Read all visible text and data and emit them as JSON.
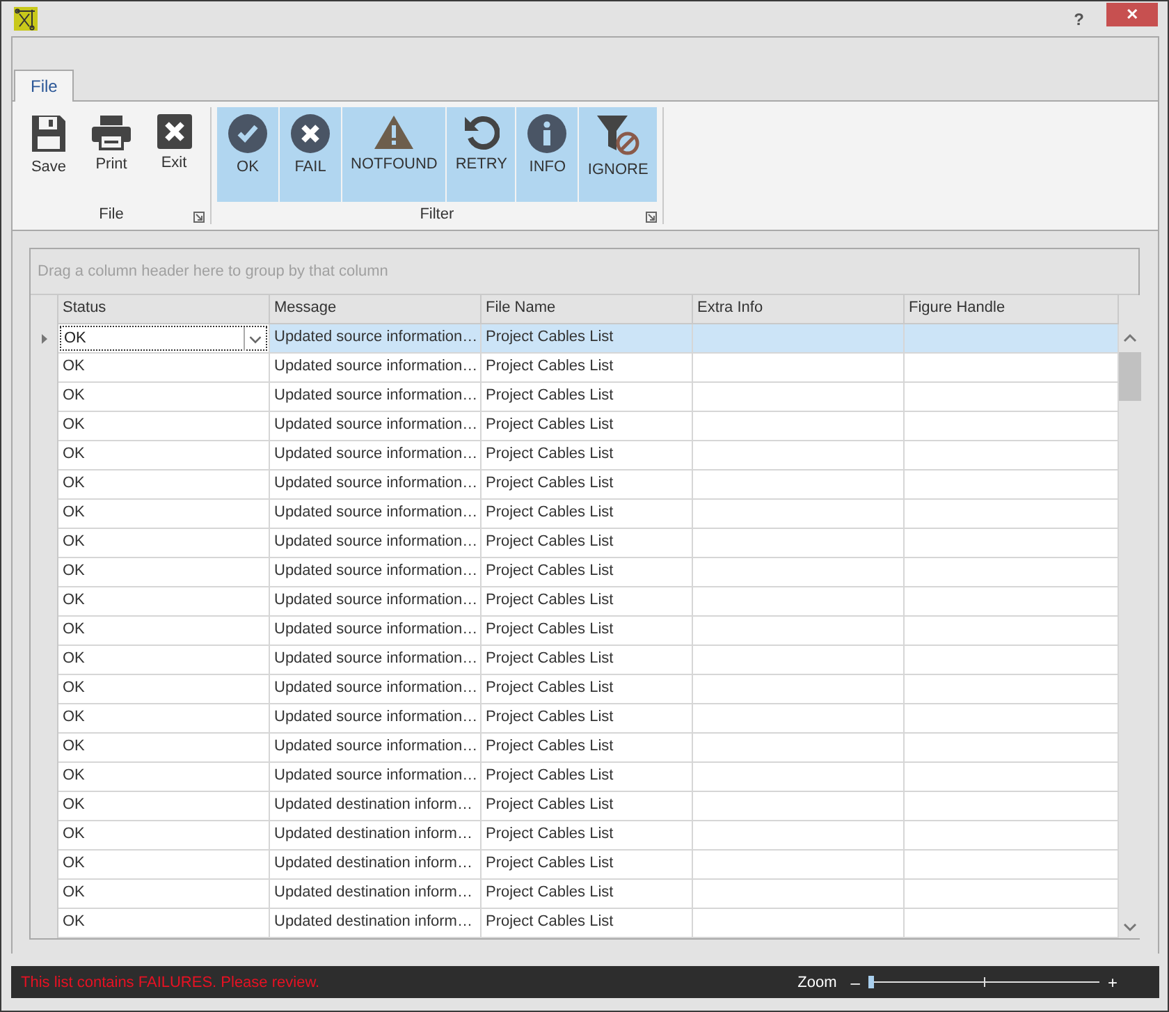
{
  "window": {
    "help": "?",
    "close": "✕"
  },
  "ribbon": {
    "tabs": [
      {
        "label": "File",
        "selected": true
      }
    ],
    "groups": [
      {
        "label": "File",
        "buttons": [
          {
            "label": "Save",
            "kind": "save",
            "selected": false
          },
          {
            "label": "Print",
            "kind": "print",
            "selected": false
          },
          {
            "label": "Exit",
            "kind": "exit",
            "selected": false
          }
        ]
      },
      {
        "label": "Filter",
        "buttons": [
          {
            "label": "OK",
            "kind": "ok",
            "selected": true
          },
          {
            "label": "FAIL",
            "kind": "fail",
            "selected": true
          },
          {
            "label": "NOTFOUND",
            "kind": "notfound",
            "selected": true
          },
          {
            "label": "RETRY",
            "kind": "retry",
            "selected": true
          },
          {
            "label": "INFO",
            "kind": "info",
            "selected": true
          },
          {
            "label": "IGNORE",
            "kind": "ignore",
            "selected": true
          }
        ]
      }
    ]
  },
  "grid": {
    "group_panel": "Drag a column header here to group by that column",
    "columns": [
      "Status",
      "Message",
      "File Name",
      "Extra Info",
      "Figure Handle"
    ],
    "rows": [
      {
        "status": "OK",
        "message": "Updated source information…",
        "file_name": "Project Cables List",
        "selected": true
      },
      {
        "status": "OK",
        "message": "Updated source information…",
        "file_name": "Project Cables List",
        "selected": false
      },
      {
        "status": "OK",
        "message": "Updated source information…",
        "file_name": "Project Cables List",
        "selected": false
      },
      {
        "status": "OK",
        "message": "Updated source information…",
        "file_name": "Project Cables List",
        "selected": false
      },
      {
        "status": "OK",
        "message": "Updated source information…",
        "file_name": "Project Cables List",
        "selected": false
      },
      {
        "status": "OK",
        "message": "Updated source information…",
        "file_name": "Project Cables List",
        "selected": false
      },
      {
        "status": "OK",
        "message": "Updated source information…",
        "file_name": "Project Cables List",
        "selected": false
      },
      {
        "status": "OK",
        "message": "Updated source information…",
        "file_name": "Project Cables List",
        "selected": false
      },
      {
        "status": "OK",
        "message": "Updated source information…",
        "file_name": "Project Cables List",
        "selected": false
      },
      {
        "status": "OK",
        "message": "Updated source information…",
        "file_name": "Project Cables List",
        "selected": false
      },
      {
        "status": "OK",
        "message": "Updated source information…",
        "file_name": "Project Cables List",
        "selected": false
      },
      {
        "status": "OK",
        "message": "Updated source information…",
        "file_name": "Project Cables List",
        "selected": false
      },
      {
        "status": "OK",
        "message": "Updated source information…",
        "file_name": "Project Cables List",
        "selected": false
      },
      {
        "status": "OK",
        "message": "Updated source information…",
        "file_name": "Project Cables List",
        "selected": false
      },
      {
        "status": "OK",
        "message": "Updated source information…",
        "file_name": "Project Cables List",
        "selected": false
      },
      {
        "status": "OK",
        "message": "Updated source information…",
        "file_name": "Project Cables List",
        "selected": false
      },
      {
        "status": "OK",
        "message": "Updated destination inform…",
        "file_name": "Project Cables List",
        "selected": false
      },
      {
        "status": "OK",
        "message": "Updated destination inform…",
        "file_name": "Project Cables List",
        "selected": false
      },
      {
        "status": "OK",
        "message": "Updated destination inform…",
        "file_name": "Project Cables List",
        "selected": false
      },
      {
        "status": "OK",
        "message": "Updated destination inform…",
        "file_name": "Project Cables List",
        "selected": false
      },
      {
        "status": "OK",
        "message": "Updated destination inform…",
        "file_name": "Project Cables List",
        "selected": false
      }
    ]
  },
  "status_bar": {
    "message": "This list contains FAILURES. Please review.",
    "zoom_label": "Zoom",
    "zoom_minus": "–",
    "zoom_plus": "+",
    "zoom": {
      "level": 0.0
    }
  }
}
